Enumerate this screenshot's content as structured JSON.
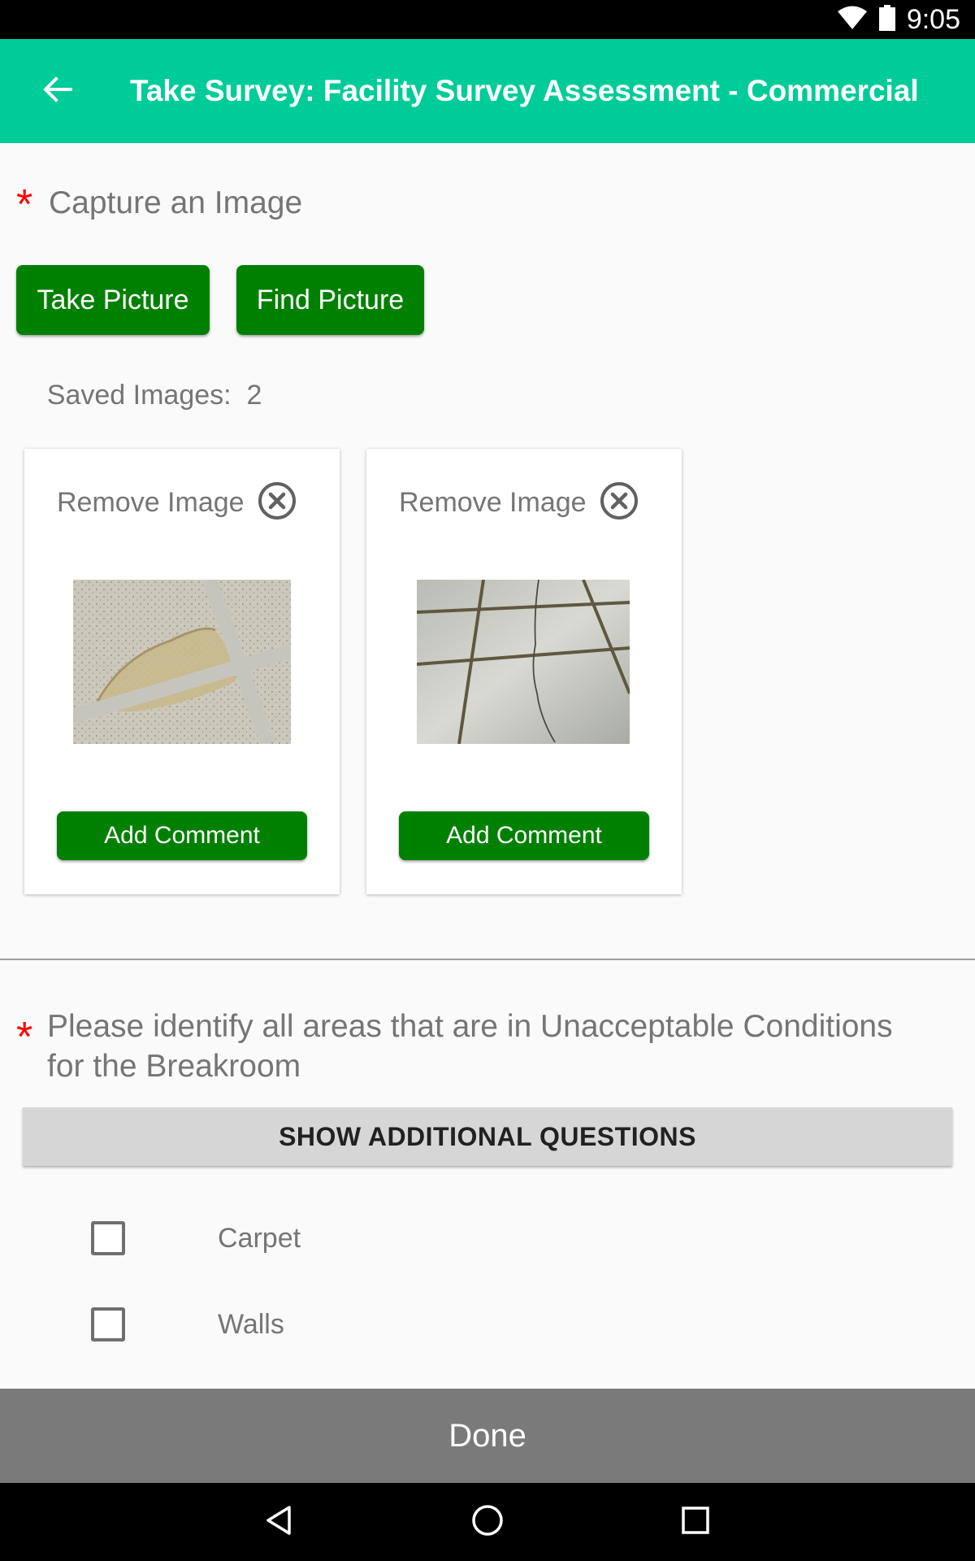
{
  "status_bar": {
    "time": "9:05",
    "icons": [
      "wifi-icon",
      "battery-icon"
    ]
  },
  "app_bar": {
    "back_icon": "arrow-back-icon",
    "title": "Take Survey: Facility Survey Assessment - Commercial"
  },
  "question1": {
    "required_mark": "*",
    "text": "Capture an Image",
    "take_picture_label": "Take Picture",
    "find_picture_label": "Find Picture",
    "saved_images_label": "Saved Images:",
    "saved_images_count": "2",
    "images": [
      {
        "remove_label": "Remove Image",
        "remove_icon": "circle-x-icon",
        "photo": "ceiling-tile-water-damage",
        "comment_label": "Add Comment"
      },
      {
        "remove_label": "Remove Image",
        "remove_icon": "circle-x-icon",
        "photo": "cracked-floor-tile",
        "comment_label": "Add Comment"
      }
    ]
  },
  "question2": {
    "required_mark": "*",
    "text_line1": "Please identify all areas that are in Unacceptable Conditions",
    "text_line2": "for the Breakroom",
    "show_more_label": "SHOW ADDITIONAL QUESTIONS",
    "options": [
      {
        "label": "Carpet",
        "checked": false
      },
      {
        "label": "Walls",
        "checked": false
      }
    ]
  },
  "done_label": "Done",
  "nav": [
    "back-triangle-icon",
    "home-circle-icon",
    "recents-square-icon"
  ],
  "colors": {
    "app_bar": "#00cc99",
    "button_green": "#008000",
    "required": "#ff0000",
    "done_bar": "#7a7a7a"
  }
}
